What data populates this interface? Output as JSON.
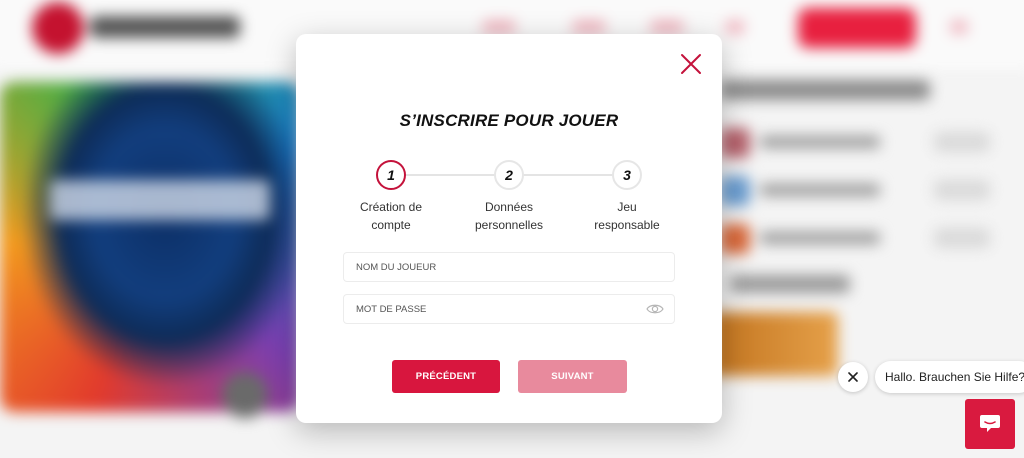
{
  "modal": {
    "title": "S’INSCRIRE POUR JOUER",
    "steps": [
      {
        "number": "1",
        "label_line1": "Création de",
        "label_line2": "compte",
        "active": true
      },
      {
        "number": "2",
        "label_line1": "Données",
        "label_line2": "personnelles",
        "active": false
      },
      {
        "number": "3",
        "label_line1": "Jeu",
        "label_line2": "responsable",
        "active": false
      }
    ],
    "fields": {
      "username_placeholder": "NOM DU JOUEUR",
      "password_placeholder": "MOT DE PASSE",
      "username_value": "",
      "password_value": ""
    },
    "buttons": {
      "previous_label": "PRÉCÉDENT",
      "next_label": "SUIVANT"
    },
    "icons": {
      "close": "close-icon",
      "password_toggle": "eye-icon"
    }
  },
  "chat": {
    "greeting": "Hallo. Brauchen Sie Hilfe?",
    "icons": {
      "dismiss": "close-icon",
      "launcher": "chat-icon"
    }
  },
  "colors": {
    "accent": "#d8163e",
    "accent_disabled": "#e88a9d",
    "active_step_border": "#c4123b",
    "chat_launcher": "#d91a3f"
  }
}
